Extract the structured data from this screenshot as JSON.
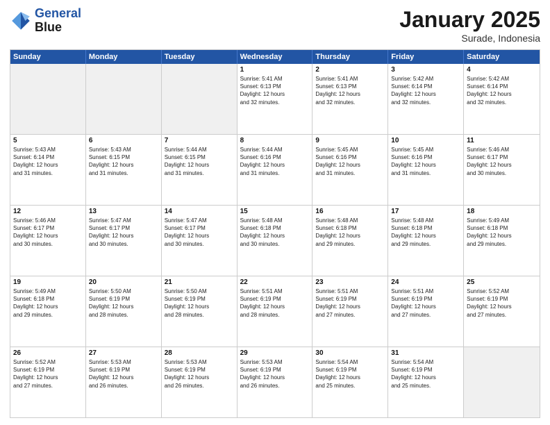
{
  "header": {
    "logo_line1": "General",
    "logo_line2": "Blue",
    "main_title": "January 2025",
    "subtitle": "Surade, Indonesia"
  },
  "days_of_week": [
    "Sunday",
    "Monday",
    "Tuesday",
    "Wednesday",
    "Thursday",
    "Friday",
    "Saturday"
  ],
  "weeks": [
    [
      {
        "day": "",
        "info": ""
      },
      {
        "day": "",
        "info": ""
      },
      {
        "day": "",
        "info": ""
      },
      {
        "day": "1",
        "info": "Sunrise: 5:41 AM\nSunset: 6:13 PM\nDaylight: 12 hours\nand 32 minutes."
      },
      {
        "day": "2",
        "info": "Sunrise: 5:41 AM\nSunset: 6:13 PM\nDaylight: 12 hours\nand 32 minutes."
      },
      {
        "day": "3",
        "info": "Sunrise: 5:42 AM\nSunset: 6:14 PM\nDaylight: 12 hours\nand 32 minutes."
      },
      {
        "day": "4",
        "info": "Sunrise: 5:42 AM\nSunset: 6:14 PM\nDaylight: 12 hours\nand 32 minutes."
      }
    ],
    [
      {
        "day": "5",
        "info": "Sunrise: 5:43 AM\nSunset: 6:14 PM\nDaylight: 12 hours\nand 31 minutes."
      },
      {
        "day": "6",
        "info": "Sunrise: 5:43 AM\nSunset: 6:15 PM\nDaylight: 12 hours\nand 31 minutes."
      },
      {
        "day": "7",
        "info": "Sunrise: 5:44 AM\nSunset: 6:15 PM\nDaylight: 12 hours\nand 31 minutes."
      },
      {
        "day": "8",
        "info": "Sunrise: 5:44 AM\nSunset: 6:16 PM\nDaylight: 12 hours\nand 31 minutes."
      },
      {
        "day": "9",
        "info": "Sunrise: 5:45 AM\nSunset: 6:16 PM\nDaylight: 12 hours\nand 31 minutes."
      },
      {
        "day": "10",
        "info": "Sunrise: 5:45 AM\nSunset: 6:16 PM\nDaylight: 12 hours\nand 31 minutes."
      },
      {
        "day": "11",
        "info": "Sunrise: 5:46 AM\nSunset: 6:17 PM\nDaylight: 12 hours\nand 30 minutes."
      }
    ],
    [
      {
        "day": "12",
        "info": "Sunrise: 5:46 AM\nSunset: 6:17 PM\nDaylight: 12 hours\nand 30 minutes."
      },
      {
        "day": "13",
        "info": "Sunrise: 5:47 AM\nSunset: 6:17 PM\nDaylight: 12 hours\nand 30 minutes."
      },
      {
        "day": "14",
        "info": "Sunrise: 5:47 AM\nSunset: 6:17 PM\nDaylight: 12 hours\nand 30 minutes."
      },
      {
        "day": "15",
        "info": "Sunrise: 5:48 AM\nSunset: 6:18 PM\nDaylight: 12 hours\nand 30 minutes."
      },
      {
        "day": "16",
        "info": "Sunrise: 5:48 AM\nSunset: 6:18 PM\nDaylight: 12 hours\nand 29 minutes."
      },
      {
        "day": "17",
        "info": "Sunrise: 5:48 AM\nSunset: 6:18 PM\nDaylight: 12 hours\nand 29 minutes."
      },
      {
        "day": "18",
        "info": "Sunrise: 5:49 AM\nSunset: 6:18 PM\nDaylight: 12 hours\nand 29 minutes."
      }
    ],
    [
      {
        "day": "19",
        "info": "Sunrise: 5:49 AM\nSunset: 6:18 PM\nDaylight: 12 hours\nand 29 minutes."
      },
      {
        "day": "20",
        "info": "Sunrise: 5:50 AM\nSunset: 6:19 PM\nDaylight: 12 hours\nand 28 minutes."
      },
      {
        "day": "21",
        "info": "Sunrise: 5:50 AM\nSunset: 6:19 PM\nDaylight: 12 hours\nand 28 minutes."
      },
      {
        "day": "22",
        "info": "Sunrise: 5:51 AM\nSunset: 6:19 PM\nDaylight: 12 hours\nand 28 minutes."
      },
      {
        "day": "23",
        "info": "Sunrise: 5:51 AM\nSunset: 6:19 PM\nDaylight: 12 hours\nand 27 minutes."
      },
      {
        "day": "24",
        "info": "Sunrise: 5:51 AM\nSunset: 6:19 PM\nDaylight: 12 hours\nand 27 minutes."
      },
      {
        "day": "25",
        "info": "Sunrise: 5:52 AM\nSunset: 6:19 PM\nDaylight: 12 hours\nand 27 minutes."
      }
    ],
    [
      {
        "day": "26",
        "info": "Sunrise: 5:52 AM\nSunset: 6:19 PM\nDaylight: 12 hours\nand 27 minutes."
      },
      {
        "day": "27",
        "info": "Sunrise: 5:53 AM\nSunset: 6:19 PM\nDaylight: 12 hours\nand 26 minutes."
      },
      {
        "day": "28",
        "info": "Sunrise: 5:53 AM\nSunset: 6:19 PM\nDaylight: 12 hours\nand 26 minutes."
      },
      {
        "day": "29",
        "info": "Sunrise: 5:53 AM\nSunset: 6:19 PM\nDaylight: 12 hours\nand 26 minutes."
      },
      {
        "day": "30",
        "info": "Sunrise: 5:54 AM\nSunset: 6:19 PM\nDaylight: 12 hours\nand 25 minutes."
      },
      {
        "day": "31",
        "info": "Sunrise: 5:54 AM\nSunset: 6:19 PM\nDaylight: 12 hours\nand 25 minutes."
      },
      {
        "day": "",
        "info": ""
      }
    ]
  ]
}
